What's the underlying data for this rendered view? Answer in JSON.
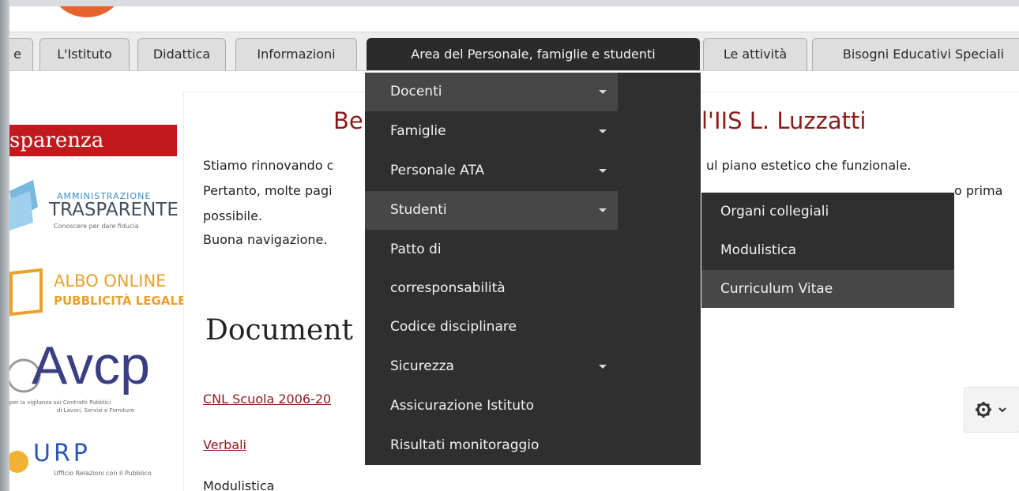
{
  "nav": {
    "tabs": [
      "e",
      "L'Istituto",
      "Didattica",
      "Informazioni",
      "Area del Personale, famiglie e studenti",
      "Le attività",
      "Bisogni Educativi Speciali"
    ]
  },
  "sidebar": {
    "title": "sparenza",
    "banners": [
      {
        "line1": "AMMINISTRAZIONE",
        "line2": "TRASPARENTE",
        "line3": "Conoscere per dare fiducia"
      },
      {
        "line1": "ALBO ONLINE",
        "line2": "PUBBLICITÀ LEGALE"
      },
      {
        "line1": "Avcp",
        "line2": "per la vigilanza sui Contratti Pubblici",
        "line3": "di Lavori, Servizi e Forniture"
      },
      {
        "line1": "URP",
        "line2": "Ufficio Relazioni con il Pubblico"
      }
    ]
  },
  "main": {
    "welcome_left": "Be",
    "welcome_right": "l'IIS L. Luzzatti",
    "para1_left": "Stiamo rinnovando c",
    "para1_right": "ul piano estetico che funzionale.",
    "para2_left": "Pertanto, molte pagi",
    "para2_right": "o prima",
    "para3": "possibile.",
    "para4": "Buona navigazione.",
    "heading": "Document",
    "links": [
      "CNL Scuola 2006-20",
      "Verbali",
      "Modulistica"
    ]
  },
  "dropdown": {
    "items": [
      "Docenti",
      "Famiglie",
      "Personale ATA",
      "Studenti",
      "Patto di",
      "corresponsabilità",
      "Codice disciplinare",
      "Sicurezza",
      "Assicurazione Istituto",
      "Risultati monitoraggio"
    ]
  },
  "submenu": {
    "items": [
      "Organi collegiali",
      "Modulistica",
      "Curriculum Vitae"
    ]
  },
  "colors": {
    "brand_red": "#c2191d",
    "dark_menu": "#2f2f2f",
    "link": "#8b1a1a"
  }
}
